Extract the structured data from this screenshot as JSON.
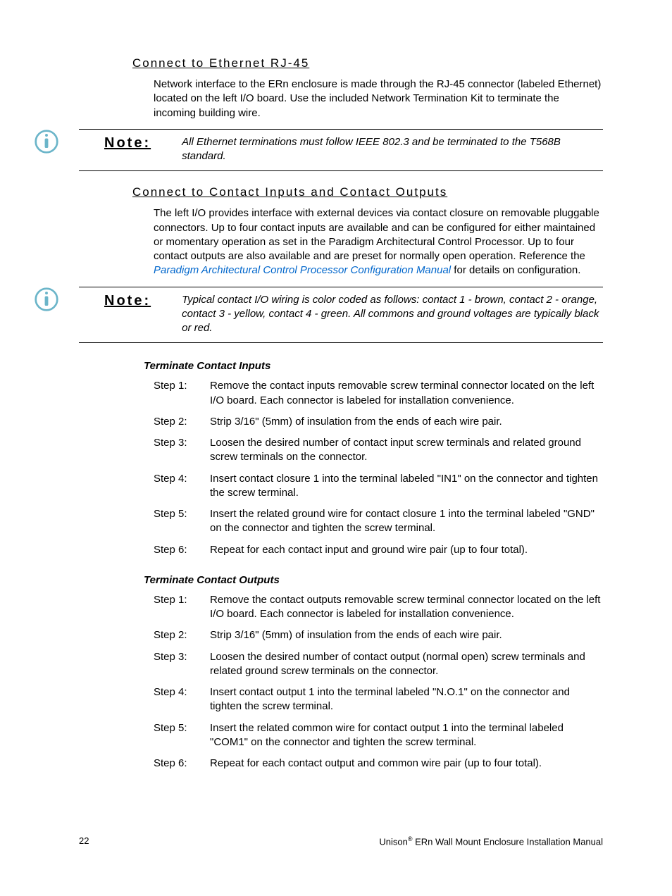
{
  "sections": {
    "ethernet": {
      "heading": "Connect to Ethernet RJ-45",
      "body": "Network interface to the ERn enclosure is made through the RJ-45 connector (labeled Ethernet) located on the left I/O board. Use the included Network Termination Kit to terminate the incoming building wire."
    },
    "contacts": {
      "heading": "Connect to Contact Inputs and Contact Outputs",
      "body_before_link": "The left I/O provides interface with external devices via contact closure on removable pluggable connectors. Up to four contact inputs are available and can be configured for either maintained or momentary operation as set in the Paradigm Architectural Control Processor. Up to four contact outputs are also available and are preset for normally open operation. Reference the ",
      "link_text": "Paradigm Architectural Control Processor Configuration Manual",
      "body_after_link": " for details on configuration."
    }
  },
  "notes": {
    "label": "Note:",
    "note1": "All Ethernet terminations must follow IEEE 802.3 and be terminated to the T568B standard.",
    "note2": "Typical contact I/O wiring is color coded as follows: contact 1 - brown, contact 2 - orange, contact 3 - yellow, contact 4 - green. All commons and ground voltages are typically black or red."
  },
  "inputs": {
    "heading": "Terminate Contact Inputs",
    "steps": [
      {
        "label": "Step 1:",
        "body": "Remove the contact inputs removable screw terminal connector located on the left I/O board. Each connector is labeled for installation convenience."
      },
      {
        "label": "Step 2:",
        "body": "Strip 3/16\" (5mm) of insulation from the ends of each wire pair."
      },
      {
        "label": "Step 3:",
        "body": "Loosen the desired number of contact input screw terminals and related ground screw terminals on the connector."
      },
      {
        "label": "Step 4:",
        "body": "Insert contact closure 1 into the terminal labeled \"IN1\" on the connector and tighten the screw terminal."
      },
      {
        "label": "Step 5:",
        "body": "Insert the related ground wire for contact closure 1 into the terminal labeled \"GND\" on the connector and tighten the screw terminal."
      },
      {
        "label": "Step 6:",
        "body": "Repeat for each contact input and ground wire pair (up to four total)."
      }
    ]
  },
  "outputs": {
    "heading": "Terminate Contact Outputs",
    "steps": [
      {
        "label": "Step 1:",
        "body": "Remove the contact outputs removable screw terminal connector located on the left I/O board. Each connector is labeled for installation convenience."
      },
      {
        "label": "Step 2:",
        "body": "Strip 3/16\" (5mm) of insulation from the ends of each wire pair."
      },
      {
        "label": "Step 3:",
        "body": "Loosen the desired number of contact output (normal open) screw terminals and related ground screw terminals on the connector."
      },
      {
        "label": "Step 4:",
        "body": "Insert contact output 1 into the terminal labeled \"N.O.1\" on the connector and tighten the screw terminal."
      },
      {
        "label": "Step 5:",
        "body": "Insert the related common wire for contact output 1 into the terminal labeled \"COM1\" on the connector and tighten the screw terminal."
      },
      {
        "label": "Step 6:",
        "body": "Repeat for each contact output and common wire pair (up to four total)."
      }
    ]
  },
  "footer": {
    "page_number": "22",
    "doc_title_prefix": "Unison",
    "doc_title_suffix": " ERn Wall Mount Enclosure Installation Manual"
  }
}
